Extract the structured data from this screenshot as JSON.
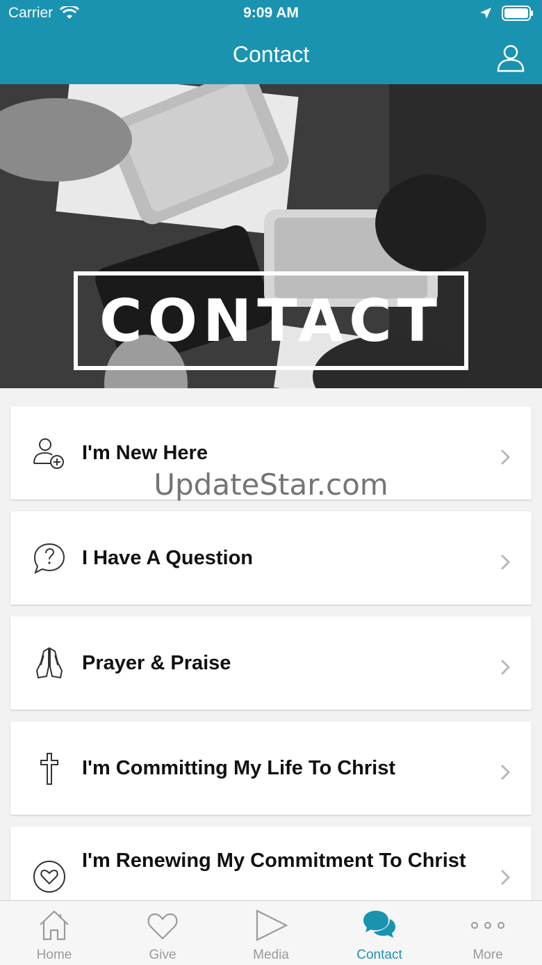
{
  "status_bar": {
    "carrier": "Carrier",
    "time": "9:09 AM"
  },
  "nav": {
    "title": "Contact",
    "profile_icon": "person-icon"
  },
  "hero": {
    "text": "CONTACT"
  },
  "watermark": "UpdateStar.com",
  "items": [
    {
      "label": "I'm New Here",
      "icon": "person-add-icon"
    },
    {
      "label": "I Have A Question",
      "icon": "question-bubble-icon"
    },
    {
      "label": "Prayer & Praise",
      "icon": "praying-hands-icon"
    },
    {
      "label": "I'm Committing My Life To Christ",
      "icon": "cross-icon"
    },
    {
      "label": "I'm Renewing My Commitment To Christ",
      "icon": "heart-circle-icon"
    }
  ],
  "tabs": [
    {
      "label": "Home",
      "icon": "home-icon"
    },
    {
      "label": "Give",
      "icon": "heart-icon"
    },
    {
      "label": "Media",
      "icon": "play-icon"
    },
    {
      "label": "Contact",
      "icon": "chat-bubbles-icon",
      "active": true
    },
    {
      "label": "More",
      "icon": "more-dots-icon"
    }
  ],
  "colors": {
    "accent": "#1a93b1",
    "inactive": "#9a9a9a"
  }
}
